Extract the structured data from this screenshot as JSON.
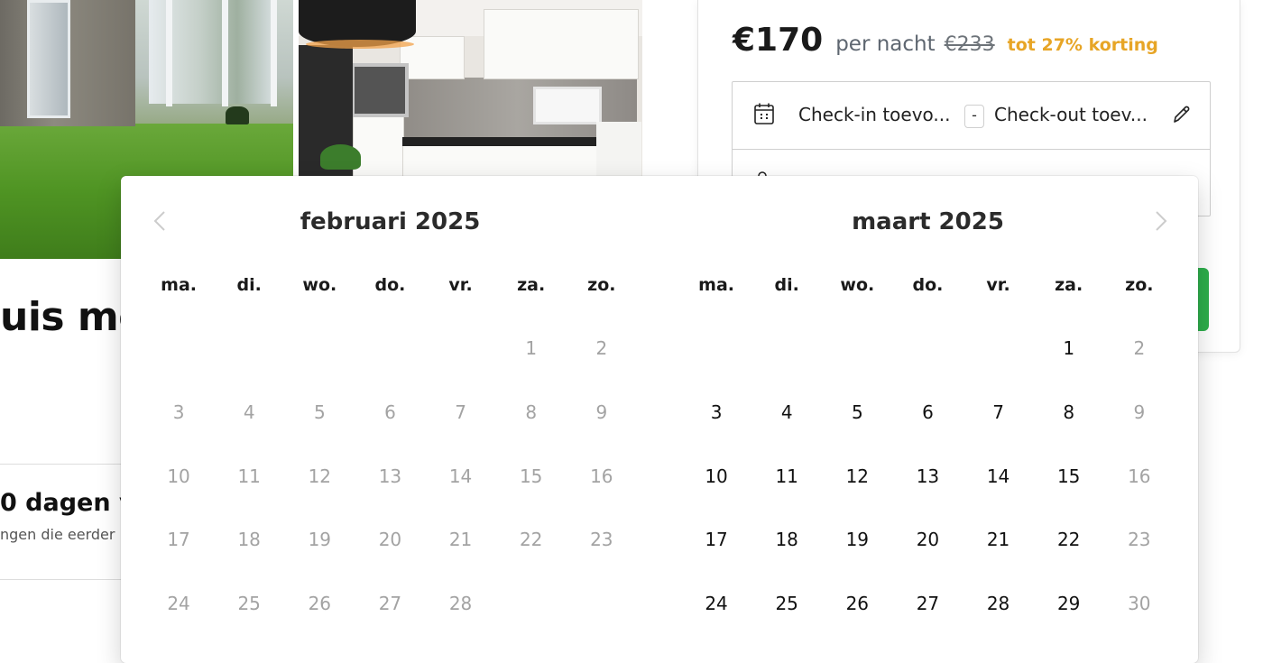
{
  "page": {
    "title_fragment": "uis me",
    "days_fragment": "0 dagen v",
    "sub_fragment": "ngen die eerder"
  },
  "booking": {
    "price": "€170",
    "per_night": "per nacht",
    "old_price": "€233",
    "discount": "tot 27% korting",
    "checkin_placeholder": "Check-in toevo...",
    "separator": "-",
    "checkout_placeholder": "Check-out toev...",
    "colors": {
      "discount": "#e7a526",
      "cta": "#2dae4b"
    }
  },
  "datepicker": {
    "weekdays": [
      "ma.",
      "di.",
      "wo.",
      "do.",
      "vr.",
      "za.",
      "zo."
    ],
    "months": [
      {
        "title": "februari 2025",
        "weeks": [
          [
            null,
            null,
            null,
            null,
            null,
            {
              "d": "1",
              "s": "disabled"
            },
            {
              "d": "2",
              "s": "disabled"
            }
          ],
          [
            {
              "d": "3",
              "s": "disabled"
            },
            {
              "d": "4",
              "s": "disabled"
            },
            {
              "d": "5",
              "s": "disabled"
            },
            {
              "d": "6",
              "s": "disabled"
            },
            {
              "d": "7",
              "s": "disabled"
            },
            {
              "d": "8",
              "s": "disabled"
            },
            {
              "d": "9",
              "s": "disabled"
            }
          ],
          [
            {
              "d": "10",
              "s": "disabled"
            },
            {
              "d": "11",
              "s": "disabled"
            },
            {
              "d": "12",
              "s": "disabled"
            },
            {
              "d": "13",
              "s": "disabled"
            },
            {
              "d": "14",
              "s": "disabled"
            },
            {
              "d": "15",
              "s": "disabled"
            },
            {
              "d": "16",
              "s": "disabled"
            }
          ],
          [
            {
              "d": "17",
              "s": "disabled"
            },
            {
              "d": "18",
              "s": "disabled"
            },
            {
              "d": "19",
              "s": "disabled"
            },
            {
              "d": "20",
              "s": "disabled"
            },
            {
              "d": "21",
              "s": "disabled"
            },
            {
              "d": "22",
              "s": "disabled"
            },
            {
              "d": "23",
              "s": "disabled"
            }
          ],
          [
            {
              "d": "24",
              "s": "disabled"
            },
            {
              "d": "25",
              "s": "disabled"
            },
            {
              "d": "26",
              "s": "disabled"
            },
            {
              "d": "27",
              "s": "disabled"
            },
            {
              "d": "28",
              "s": "disabled"
            },
            null,
            null
          ]
        ]
      },
      {
        "title": "maart 2025",
        "weeks": [
          [
            null,
            null,
            null,
            null,
            null,
            {
              "d": "1",
              "s": "available"
            },
            {
              "d": "2",
              "s": "disabled"
            }
          ],
          [
            {
              "d": "3",
              "s": "available"
            },
            {
              "d": "4",
              "s": "available"
            },
            {
              "d": "5",
              "s": "available"
            },
            {
              "d": "6",
              "s": "available"
            },
            {
              "d": "7",
              "s": "available"
            },
            {
              "d": "8",
              "s": "available"
            },
            {
              "d": "9",
              "s": "disabled"
            }
          ],
          [
            {
              "d": "10",
              "s": "available"
            },
            {
              "d": "11",
              "s": "available"
            },
            {
              "d": "12",
              "s": "available"
            },
            {
              "d": "13",
              "s": "available"
            },
            {
              "d": "14",
              "s": "available"
            },
            {
              "d": "15",
              "s": "available"
            },
            {
              "d": "16",
              "s": "disabled"
            }
          ],
          [
            {
              "d": "17",
              "s": "available"
            },
            {
              "d": "18",
              "s": "available"
            },
            {
              "d": "19",
              "s": "available"
            },
            {
              "d": "20",
              "s": "available"
            },
            {
              "d": "21",
              "s": "available"
            },
            {
              "d": "22",
              "s": "available"
            },
            {
              "d": "23",
              "s": "disabled"
            }
          ],
          [
            {
              "d": "24",
              "s": "available"
            },
            {
              "d": "25",
              "s": "available"
            },
            {
              "d": "26",
              "s": "available"
            },
            {
              "d": "27",
              "s": "available"
            },
            {
              "d": "28",
              "s": "available"
            },
            {
              "d": "29",
              "s": "available"
            },
            {
              "d": "30",
              "s": "disabled"
            }
          ]
        ]
      }
    ],
    "icons": {
      "prev": "chevron-left-icon",
      "next": "chevron-right-icon"
    }
  }
}
